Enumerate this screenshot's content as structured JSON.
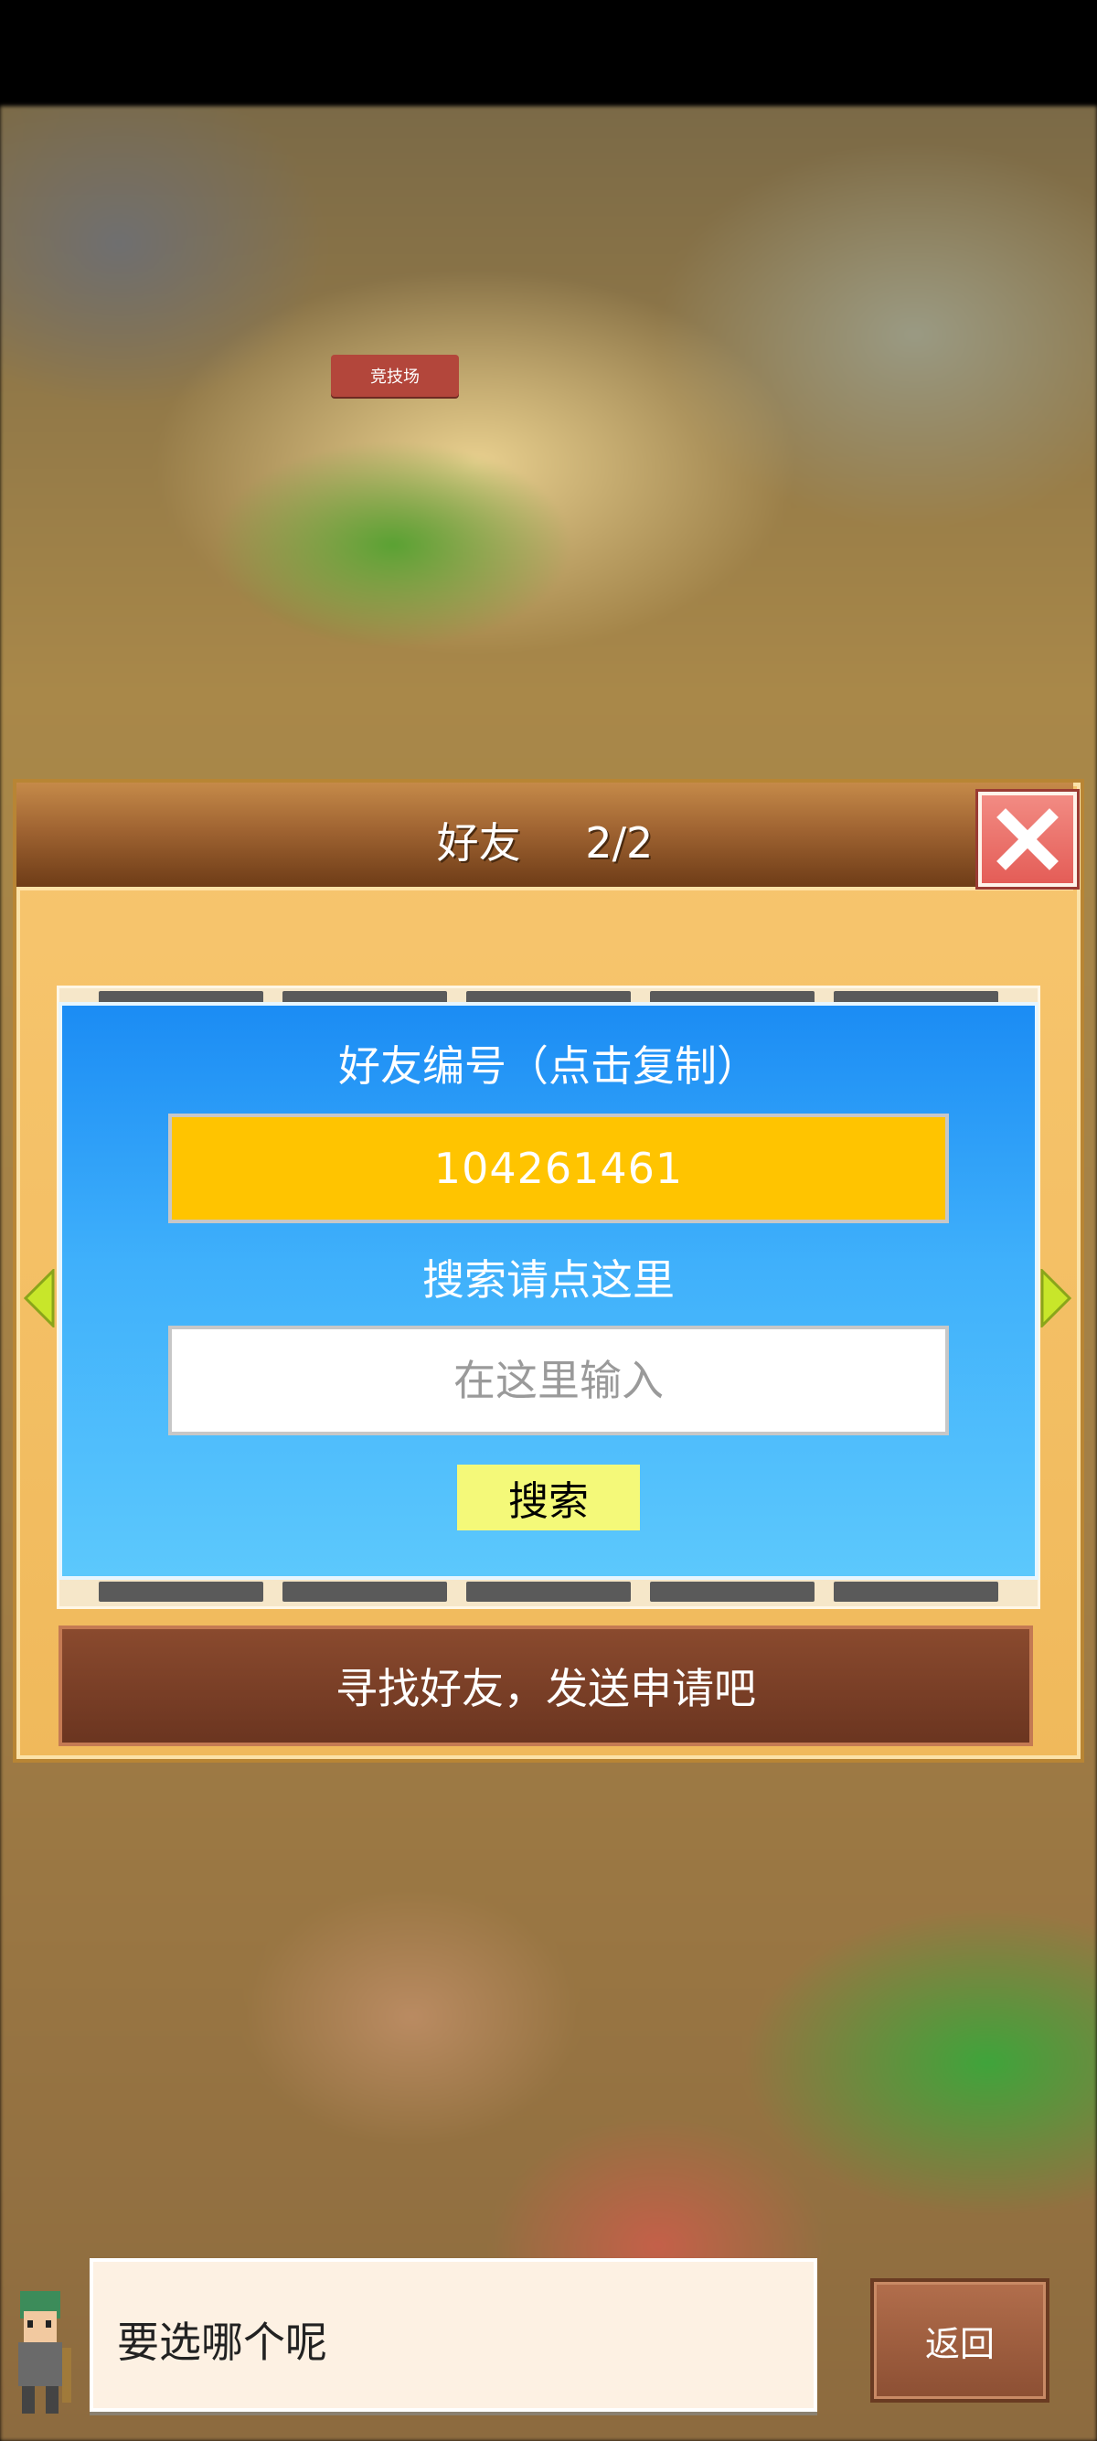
{
  "scene": {
    "arena_sign": "竞技场"
  },
  "dialog": {
    "title": "好友",
    "page_indicator": "2/2",
    "close_icon": "close-x-icon"
  },
  "friend_popup": {
    "id_label": "好友编号（点击复制）",
    "friend_id": "104261461",
    "search_label": "搜索请点这里",
    "search_placeholder": "在这里输入",
    "search_button": "搜索"
  },
  "cta": {
    "label": "寻找好友，发送申请吧"
  },
  "bottom": {
    "speech": "要选哪个呢",
    "back_button": "返回"
  },
  "colors": {
    "dialog_bg": "#f0b95b",
    "header_brown": "#6e3c17",
    "popup_blue": "#3fb0fb",
    "id_yellow": "#ffc400",
    "search_button_yellow": "#f4f979",
    "close_red": "#e45d57",
    "cta_brown": "#6b3520",
    "nav_arrow_green": "#c8e62a"
  }
}
